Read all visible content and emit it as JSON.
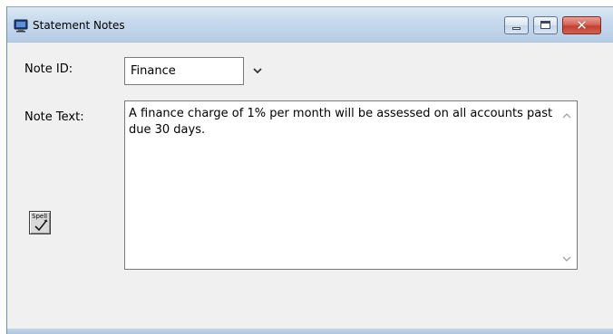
{
  "window": {
    "title": "Statement Notes",
    "app_icon": "app-monitor-icon",
    "controls": {
      "minimize_icon": "minimize-icon",
      "maximize_icon": "maximize-icon",
      "close_glyph": "✕"
    }
  },
  "form": {
    "note_id_label": "Note ID:",
    "note_id_value": "Finance",
    "note_id_dropdown_icon": "chevron-down-icon",
    "note_text_label": "Note Text:",
    "note_text_value": "A finance charge of 1% per month will be assessed on all accounts past due 30 days.",
    "spell_label": "Spell",
    "spell_icon": "spell-check-icon"
  },
  "colors": {
    "titlebar_bg": "#c6d8ec",
    "close_button": "#c3402f",
    "window_bg": "#f0f0f0"
  }
}
